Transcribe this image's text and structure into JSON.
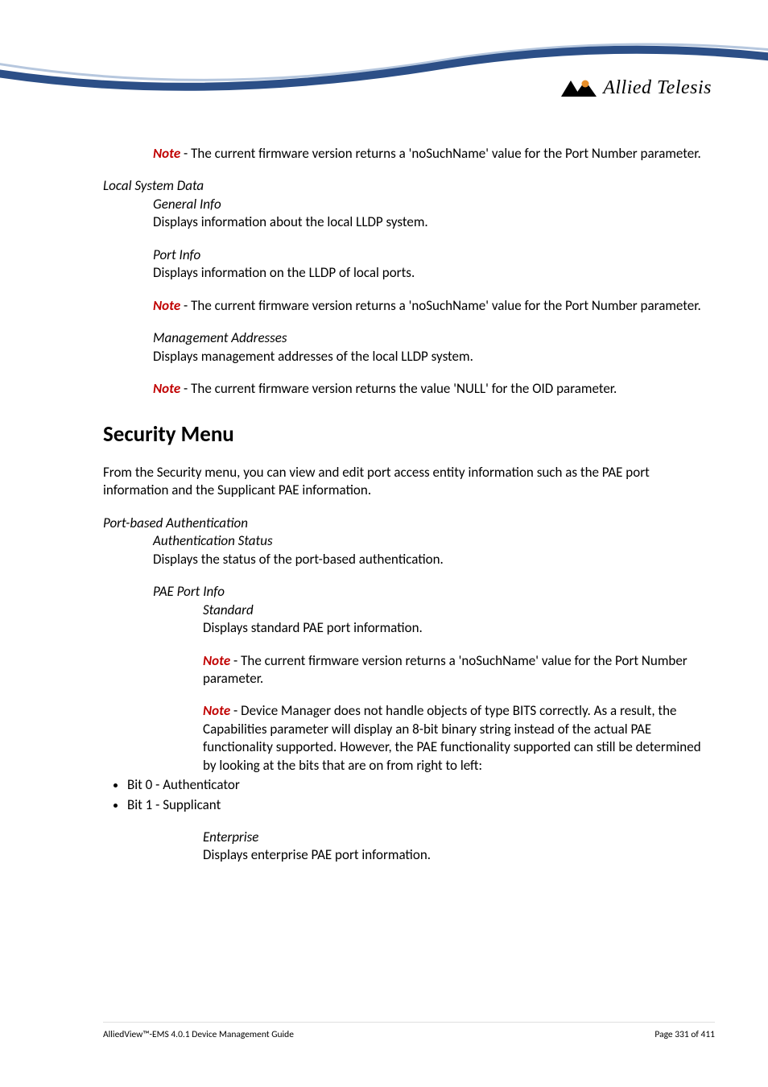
{
  "logo": {
    "text": "Allied Telesis"
  },
  "note_label": "Note",
  "block_top": {
    "note": " - The current firmware version returns a 'noSuchName' value for the Port Number parameter."
  },
  "local_system_data": {
    "heading": "Local System Data",
    "general_info": {
      "title": "General Info",
      "body": "Displays information about the local LLDP system."
    },
    "port_info": {
      "title": "Port Info",
      "body": "Displays information on the LLDP of local ports.",
      "note": " - The current firmware version returns a 'noSuchName' value for the Port Number parameter."
    },
    "mgmt_addr": {
      "title": "Management Addresses",
      "body": "Displays management addresses of the local LLDP system.",
      "note": " - The current firmware version returns the value 'NULL' for the OID parameter."
    }
  },
  "security_menu": {
    "heading": "Security Menu",
    "intro": "From the Security menu, you can view and edit port access entity information such as the PAE port information and the Supplicant PAE information.",
    "pba": {
      "heading": "Port-based Authentication",
      "auth_status": {
        "title": "Authentication Status",
        "body": "Displays the status of the port-based authentication."
      },
      "pae_port_info": {
        "title": "PAE Port Info",
        "standard": {
          "title": "Standard",
          "body": "Displays standard PAE port information.",
          "note1": " - The current firmware version returns a 'noSuchName' value for the Port Number parameter.",
          "note2": " - Device Manager does not handle objects of type BITS correctly. As a result, the Capabilities parameter will display an 8-bit binary string instead of the actual PAE functionality supported. However, the PAE functionality supported can still be determined by looking at the bits that are on from right to left:",
          "bits": [
            "Bit 0 - Authenticator",
            "Bit 1 - Supplicant"
          ]
        },
        "enterprise": {
          "title": "Enterprise",
          "body": "Displays enterprise PAE port information."
        }
      }
    }
  },
  "footer": {
    "left": "AlliedView™-EMS 4.0.1 Device Management Guide",
    "right": "Page 331 of 411"
  }
}
